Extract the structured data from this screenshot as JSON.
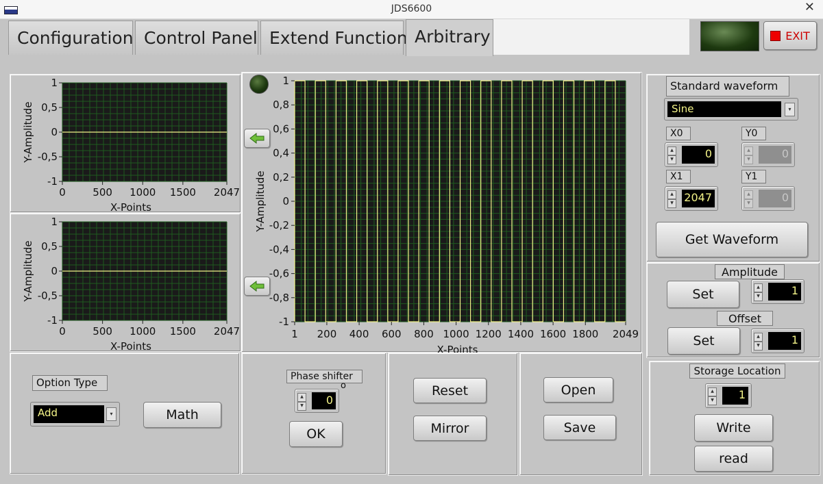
{
  "window": {
    "title": "JDS6600",
    "close_glyph": "✕"
  },
  "tabs": [
    "Configuration",
    "Control Panel",
    "Extend Function",
    "Arbitrary"
  ],
  "exit_button": {
    "label": "EXIT"
  },
  "small_charts": [
    {
      "x_ticks": [
        "0",
        "500",
        "1000",
        "1500",
        "2047"
      ],
      "y_ticks": [
        "1",
        "0,5",
        "0",
        "-0,5",
        "-1"
      ],
      "xlabel": "X-Points",
      "ylabel": "Y-Amplitude"
    },
    {
      "x_ticks": [
        "0",
        "500",
        "1000",
        "1500",
        "2047"
      ],
      "y_ticks": [
        "1",
        "0,5",
        "0",
        "-0,5",
        "-1"
      ],
      "xlabel": "X-Points",
      "ylabel": "Y-Amplitude"
    }
  ],
  "chart_data": [
    {
      "type": "line",
      "xlim": [
        0,
        2047
      ],
      "ylim": [
        -1,
        1
      ],
      "xlabel": "X-Points",
      "ylabel": "Y-Amplitude",
      "x": [
        0,
        2047
      ],
      "values": [
        0,
        0
      ],
      "grid": true
    },
    {
      "type": "line",
      "xlim": [
        0,
        2047
      ],
      "ylim": [
        -1,
        1
      ],
      "xlabel": "X-Points",
      "ylabel": "Y-Amplitude",
      "x": [
        0,
        2047
      ],
      "values": [
        0,
        0
      ],
      "grid": true
    },
    {
      "type": "line",
      "xlim": [
        1,
        2049
      ],
      "ylim": [
        -1,
        1
      ],
      "xlabel": "X-Points",
      "ylabel": "Y-Amplitude",
      "x_ticks": [
        "1",
        "200",
        "400",
        "600",
        "800",
        "1000",
        "1200",
        "1400",
        "1600",
        "1800",
        "2049"
      ],
      "y_ticks": [
        "1",
        "0,8",
        "0,6",
        "0,4",
        "0,2",
        "0",
        "-0,2",
        "-0,4",
        "-0,6",
        "-0,8",
        "-1"
      ],
      "waveform": "square",
      "cycles": 16,
      "high": 1,
      "low": -1,
      "grid": true
    }
  ],
  "standard_waveform": {
    "label": "Standard waveform",
    "value": "Sine"
  },
  "x0": {
    "label": "X0",
    "value": "0"
  },
  "y0": {
    "label": "Y0",
    "value": "0"
  },
  "x1": {
    "label": "X1",
    "value": "2047"
  },
  "y1": {
    "label": "Y1",
    "value": "0"
  },
  "get_waveform": "Get Waveform",
  "amplitude": {
    "label": "Amplitude",
    "set_label": "Set",
    "value": "1"
  },
  "offset": {
    "label": "Offset",
    "set_label": "Set",
    "value": "1"
  },
  "storage": {
    "label": "Storage Location",
    "value": "1",
    "write_label": "Write",
    "read_label": "read"
  },
  "option_type": {
    "label": "Option Type",
    "value": "Add",
    "math_label": "Math"
  },
  "phase_shifter": {
    "label": "Phase shifter",
    "value": "0",
    "unit": "o",
    "ok_label": "OK"
  },
  "edit_buttons": {
    "reset": "Reset",
    "mirror": "Mirror"
  },
  "file_buttons": {
    "open": "Open",
    "save": "Save"
  },
  "colors": {
    "plot_bg": "#1a1a1a",
    "grid": "#1f5a1f",
    "trace": "#f2f28a",
    "led": "#1e3a10"
  }
}
